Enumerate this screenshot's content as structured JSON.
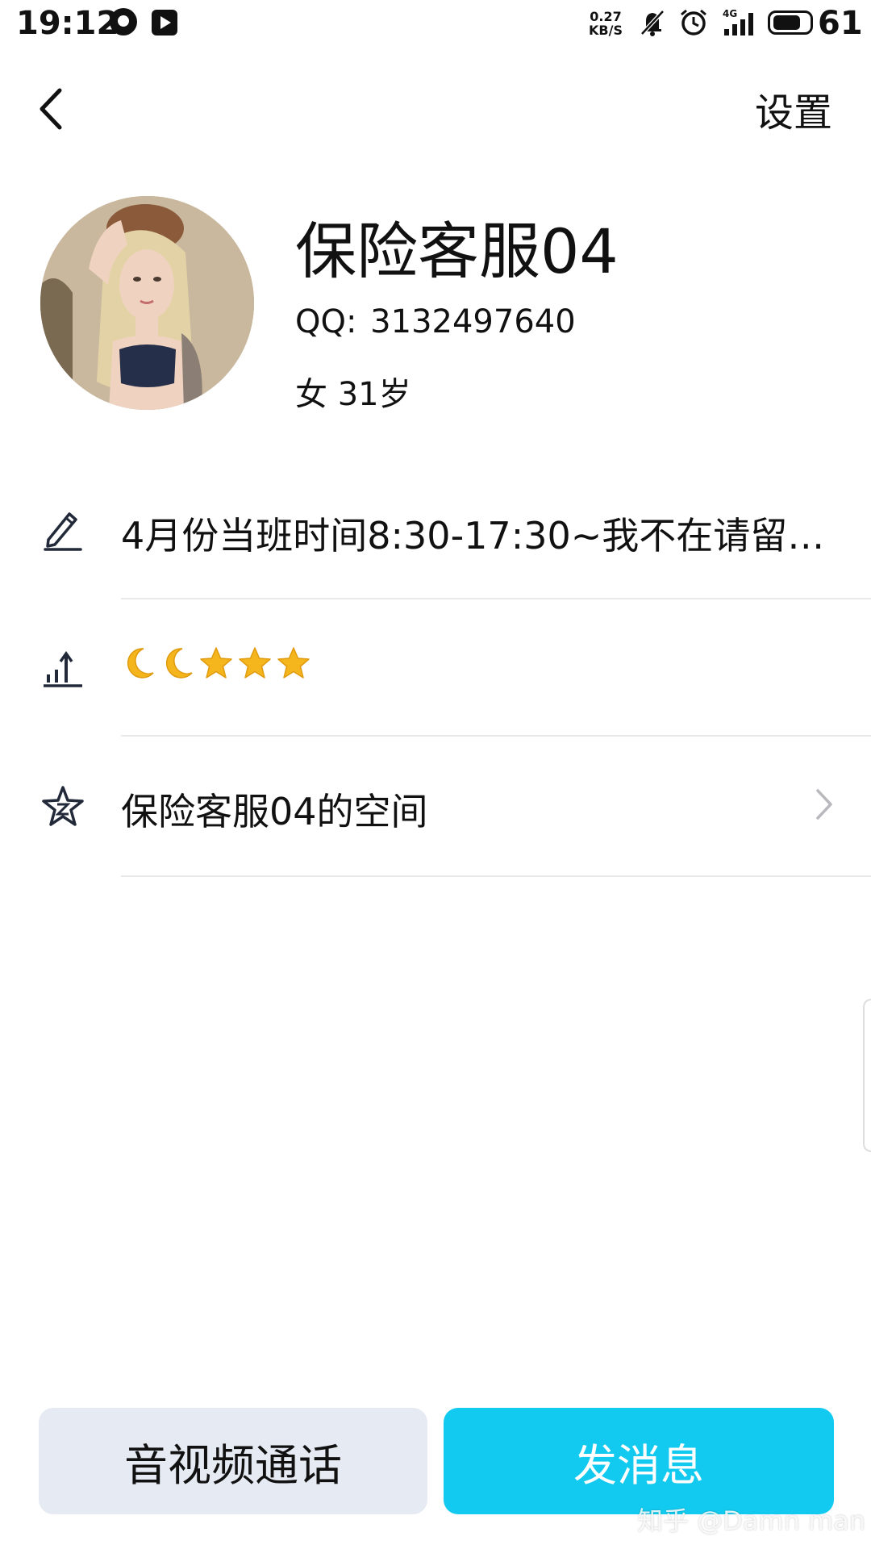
{
  "status_bar": {
    "time": "19:12",
    "net_speed_value": "0.27",
    "net_speed_unit": "KB/S",
    "network_type": "4G",
    "battery": "61"
  },
  "header": {
    "settings_label": "设置"
  },
  "profile": {
    "name": "保险客服04",
    "qq_label": "QQ:",
    "qq_number": "3132497640",
    "gender_age": "女 31岁"
  },
  "rows": {
    "signature": "4月份当班时间8:30-17:30~我不在请留言…",
    "level_icons": [
      "moon",
      "moon",
      "star",
      "star",
      "star"
    ],
    "space_label": "保险客服04的空间"
  },
  "actions": {
    "call_label": "音视频通话",
    "message_label": "发消息"
  },
  "watermark": "知乎 @Damn man",
  "colors": {
    "primary_button": "#12caef",
    "secondary_button": "#e6ebf3",
    "level_gold": "#f5b51c"
  }
}
